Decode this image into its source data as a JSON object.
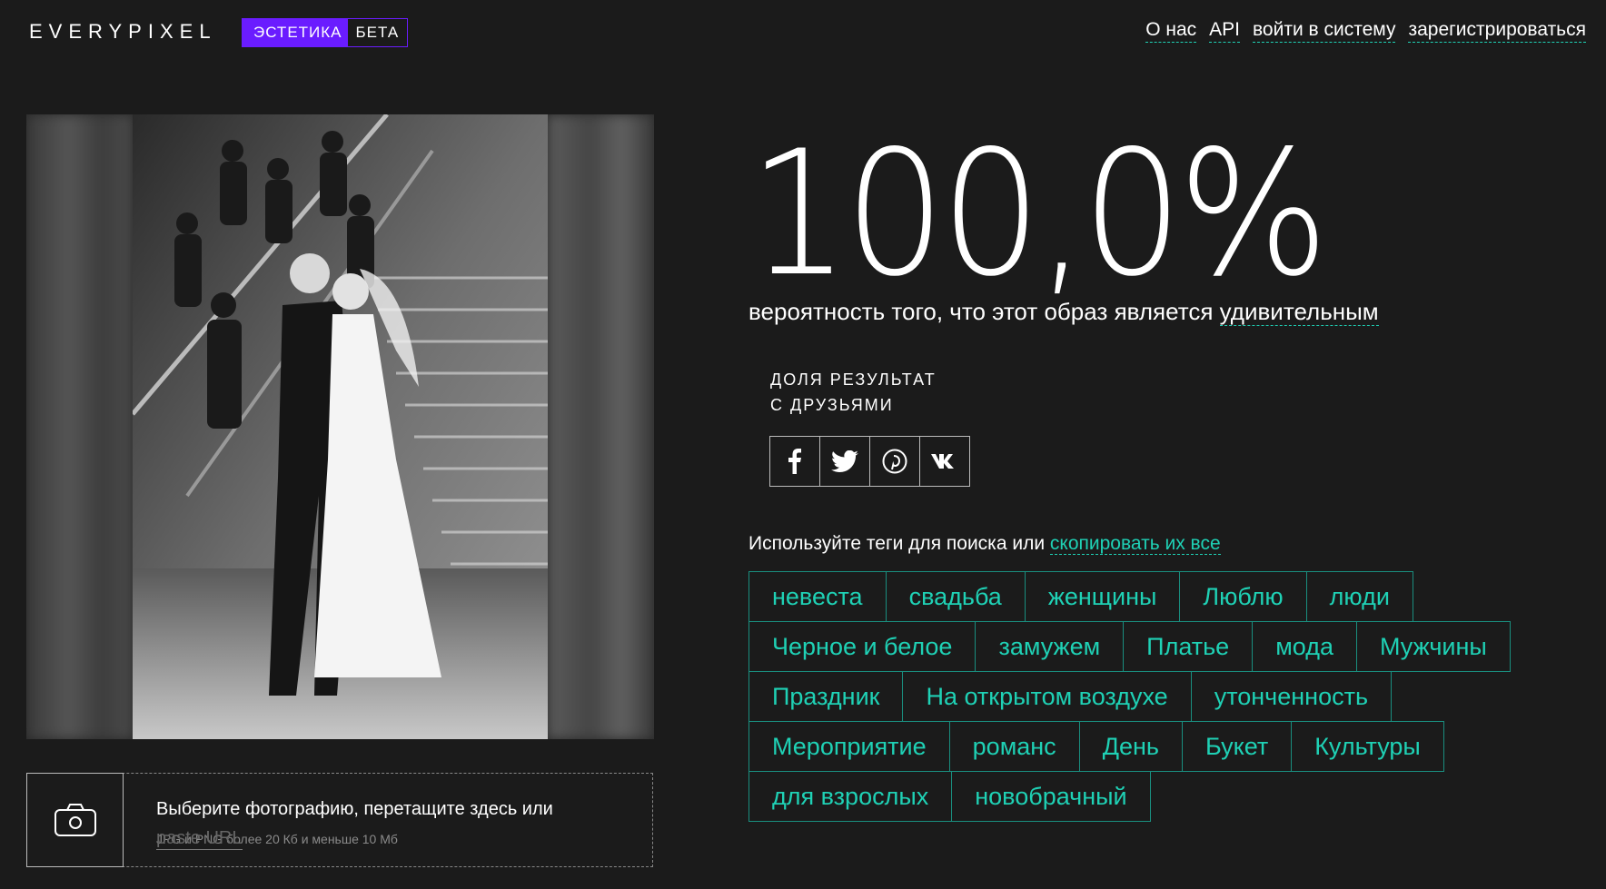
{
  "header": {
    "logo": "EVERYPIXEL",
    "badge_main": "ЭСТЕТИКА",
    "badge_beta": "БЕТА",
    "nav": [
      "О нас",
      "API",
      "войти в систему",
      "зарегистрироваться"
    ]
  },
  "result": {
    "score": "100,0%",
    "probability_prefix": "вероятность того, что этот образ является ",
    "probability_highlight": "удивительным"
  },
  "share": {
    "title_line1": "ДОЛЯ РЕЗУЛЬТАТ",
    "title_line2": "С ДРУЗЬЯМИ",
    "networks": [
      "facebook-icon",
      "twitter-icon",
      "pinterest-icon",
      "vk-icon"
    ]
  },
  "tags_section": {
    "intro": "Используйте теги для поиска или ",
    "copy_link": "скопировать их все",
    "rows": [
      [
        "невеста",
        "свадьба",
        "женщины",
        "Люблю",
        "люди"
      ],
      [
        "Черное и белое",
        "замужем",
        "Платье",
        "мода",
        "Мужчины"
      ],
      [
        "Праздник",
        "На открытом воздухе",
        "утонченность"
      ],
      [
        "Мероприятие",
        "романс",
        "День",
        "Букет",
        "Культуры"
      ],
      [
        "для взрослых",
        "новобрачный"
      ]
    ]
  },
  "upload": {
    "main_text": "Выберите фотографию, перетащите здесь или",
    "paste_url": "paste URL",
    "sub_text": "JPG и PNG более 20 Кб и меньше 10 Мб"
  },
  "colors": {
    "background": "#1b1b1b",
    "accent": "#1fd1b5",
    "badge": "#6a1cff",
    "tag_border": "#1a8e7f"
  }
}
